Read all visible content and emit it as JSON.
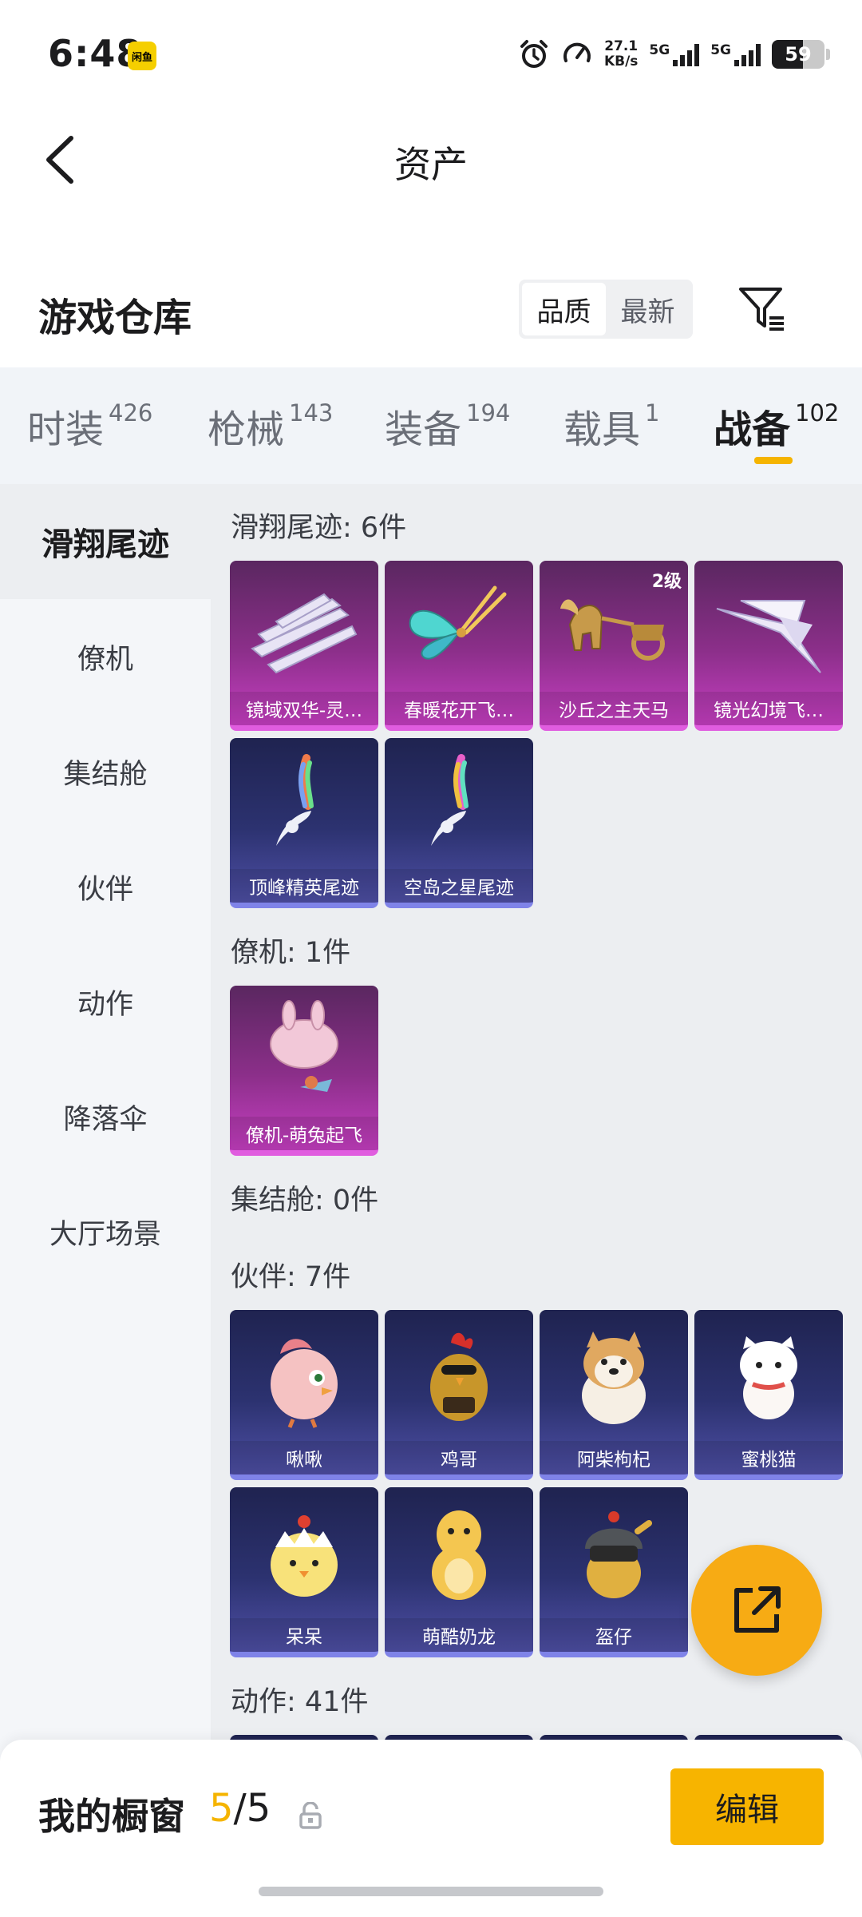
{
  "status_bar": {
    "time": "6:48",
    "badge": "闲鱼",
    "speed_value": "27.1",
    "speed_unit": "KB/s",
    "net1": "5G",
    "net2": "5G",
    "battery": "59"
  },
  "header": {
    "title": "资产"
  },
  "warehouse": {
    "title": "游戏仓库",
    "sort_quality": "品质",
    "sort_newest": "最新"
  },
  "tabs": [
    {
      "label": "时装",
      "count": "426"
    },
    {
      "label": "枪械",
      "count": "143"
    },
    {
      "label": "装备",
      "count": "194"
    },
    {
      "label": "载具",
      "count": "1"
    },
    {
      "label": "战备",
      "count": "102"
    }
  ],
  "sidebar": [
    {
      "label": "滑翔尾迹"
    },
    {
      "label": "僚机"
    },
    {
      "label": "集结舱"
    },
    {
      "label": "伙伴"
    },
    {
      "label": "动作"
    },
    {
      "label": "降落伞"
    },
    {
      "label": "大厅场景"
    }
  ],
  "sections": {
    "glide": {
      "title": "滑翔尾迹: 6件",
      "items": [
        {
          "label": "镜域双华-灵…",
          "rarity": "purple",
          "icon": "crystal-shards-icon"
        },
        {
          "label": "春暖花开飞…",
          "rarity": "purple",
          "icon": "butterfly-wings-icon"
        },
        {
          "label": "沙丘之主天马",
          "rarity": "purple",
          "icon": "pegasus-chariot-icon",
          "level": "2级"
        },
        {
          "label": "镜光幻境飞…",
          "rarity": "purple",
          "icon": "crystal-wing-icon"
        },
        {
          "label": "顶峰精英尾迹",
          "rarity": "blue",
          "icon": "rainbow-trail-icon"
        },
        {
          "label": "空岛之星尾迹",
          "rarity": "blue",
          "icon": "rainbow-trail-icon"
        }
      ]
    },
    "wingman": {
      "title": "僚机: 1件",
      "items": [
        {
          "label": "僚机-萌兔起飞",
          "rarity": "purple",
          "icon": "bunny-plane-icon"
        }
      ]
    },
    "pod": {
      "title": "集结舱: 0件"
    },
    "companion": {
      "title": "伙伴: 7件",
      "items": [
        {
          "label": "啾啾",
          "rarity": "blue",
          "icon": "pink-bird-icon"
        },
        {
          "label": "鸡哥",
          "rarity": "blue",
          "icon": "rooster-icon"
        },
        {
          "label": "阿柴枸杞",
          "rarity": "blue",
          "icon": "shiba-dog-icon"
        },
        {
          "label": "蜜桃猫",
          "rarity": "blue",
          "icon": "white-cat-icon"
        },
        {
          "label": "呆呆",
          "rarity": "blue",
          "icon": "yellow-chick-icon"
        },
        {
          "label": "萌酷奶龙",
          "rarity": "blue",
          "icon": "yellow-dino-icon"
        },
        {
          "label": "盔仔",
          "rarity": "blue",
          "icon": "helmet-chick-icon"
        }
      ]
    },
    "emote": {
      "title": "动作: 41件"
    }
  },
  "bottom": {
    "showcase_label": "我的橱窗",
    "current": "5",
    "separator": "/",
    "total": "5",
    "edit_label": "编辑"
  }
}
